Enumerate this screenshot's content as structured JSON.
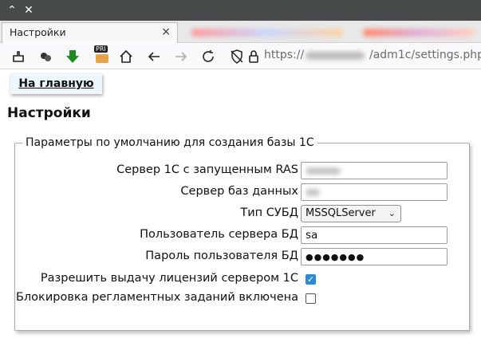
{
  "browser": {
    "tab_title": "Настройки",
    "tab_close_glyph": "×",
    "url_scheme": "https://",
    "url_path": "/adm1c/settings.php",
    "icons": [
      "extension-icon",
      "ublock-icon",
      "download-arrow-icon",
      "print-icon",
      "home-icon",
      "back-icon",
      "forward-icon",
      "reload-icon",
      "tracking-shield-icon",
      "lock-icon"
    ],
    "print_icon_label": "PRI"
  },
  "page": {
    "home_link": "На главную",
    "title": "Настройки",
    "fieldset_legend": "Параметры по умолчанию для создания базы 1С",
    "fields": [
      {
        "label": "Сервер 1С с запущенным RAS",
        "value": "",
        "blurred": true
      },
      {
        "label": "Сервер баз данных",
        "value": "",
        "blurred": true
      },
      {
        "label": "Тип СУБД",
        "value": "MSSQLServer",
        "type": "select"
      },
      {
        "label": "Пользователь сервера БД",
        "value": "sa"
      },
      {
        "label": "Пароль пользователя БД",
        "value": "●●●●●●●",
        "type": "password"
      },
      {
        "label": "Разрешить выдачу лицензий сервером 1С",
        "checked": true,
        "type": "checkbox"
      },
      {
        "label": "Блокировка регламентных заданий включена",
        "checked": false,
        "type": "checkbox"
      }
    ]
  },
  "colors": {
    "title_strip": "#474b4c",
    "checkbox_accent": "#2a8ad4",
    "download_icon": "#1f8a1f"
  }
}
